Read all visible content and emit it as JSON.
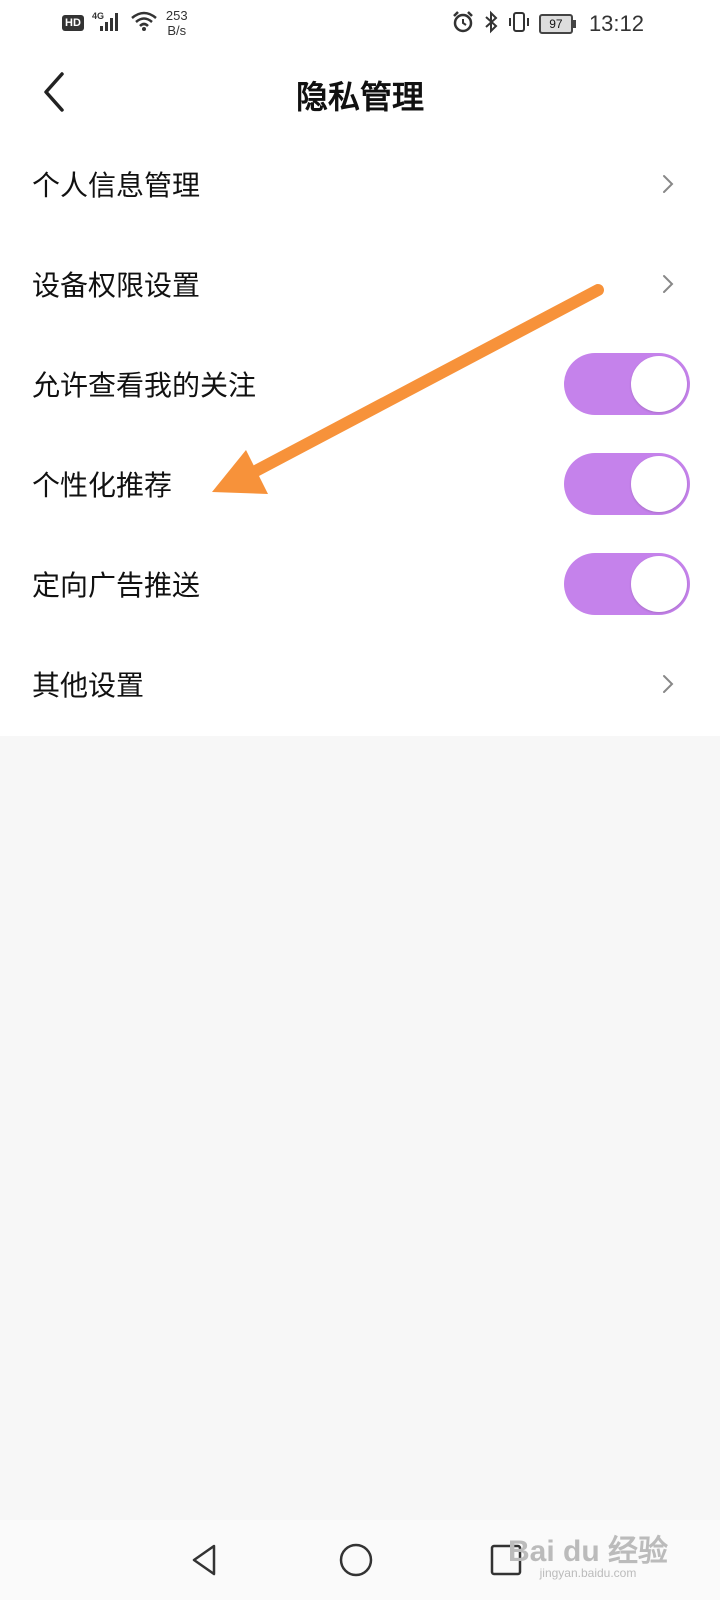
{
  "status_bar": {
    "hd": "HD",
    "network": "4G",
    "speed_value": "253",
    "speed_unit": "B/s",
    "battery": "97",
    "time": "13:12"
  },
  "header": {
    "title": "隐私管理"
  },
  "settings": [
    {
      "label": "个人信息管理",
      "control": "chevron"
    },
    {
      "label": "设备权限设置",
      "control": "chevron"
    },
    {
      "label": "允许查看我的关注",
      "control": "toggle",
      "on": true
    },
    {
      "label": "个性化推荐",
      "control": "toggle",
      "on": true
    },
    {
      "label": "定向广告推送",
      "control": "toggle",
      "on": true
    },
    {
      "label": "其他设置",
      "control": "chevron"
    }
  ],
  "colors": {
    "toggle_on": "#c582eb",
    "annotation_arrow": "#f7923a"
  },
  "watermark": {
    "brand": "Bai du 经验",
    "url": "jingyan.baidu.com"
  }
}
